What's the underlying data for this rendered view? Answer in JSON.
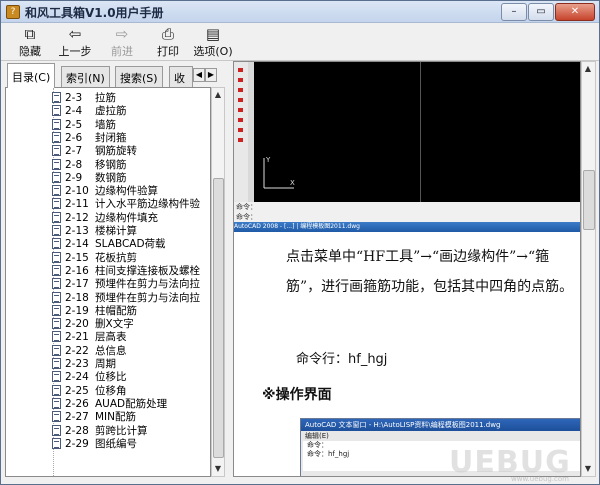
{
  "window": {
    "title": "和风工具箱V1.0用户手册",
    "app_icon_glyph": "?",
    "minimize_glyph": "–",
    "restore_glyph": "▭",
    "close_glyph": "✕"
  },
  "toolbar": {
    "hide": {
      "label": "隐藏",
      "icon": "hide-icon",
      "glyph": "⧉"
    },
    "back": {
      "label": "上一步",
      "icon": "back-arrow-icon",
      "glyph": "⇦"
    },
    "forward": {
      "label": "前进",
      "icon": "forward-arrow-icon",
      "glyph": "⇨"
    },
    "print": {
      "label": "打印",
      "icon": "print-icon",
      "glyph": "⎙"
    },
    "options": {
      "label": "选项(O)",
      "icon": "options-icon",
      "glyph": "▤"
    }
  },
  "nav": {
    "tabs": [
      {
        "label": "目录(C)",
        "active": true
      },
      {
        "label": "索引(N)",
        "active": false
      },
      {
        "label": "搜索(S)",
        "active": false
      },
      {
        "label": "收",
        "active": false
      }
    ],
    "tab_left_arrow": "◀",
    "tab_right_arrow": "▶",
    "scroll_up": "▲",
    "scroll_down": "▼",
    "items": [
      {
        "num": "2-3",
        "label": "拉筋"
      },
      {
        "num": "2-4",
        "label": "虚拉筋"
      },
      {
        "num": "2-5",
        "label": "墙筋"
      },
      {
        "num": "2-6",
        "label": "封闭箍"
      },
      {
        "num": "2-7",
        "label": "钢筋旋转"
      },
      {
        "num": "2-8",
        "label": "移钢筋"
      },
      {
        "num": "2-9",
        "label": "数钢筋"
      },
      {
        "num": "2-10",
        "label": "边缘构件验算"
      },
      {
        "num": "2-11",
        "label": "计入水平筋边缘构件验"
      },
      {
        "num": "2-12",
        "label": "边缘构件填充"
      },
      {
        "num": "2-13",
        "label": "楼梯计算"
      },
      {
        "num": "2-14",
        "label": "SLABCAD荷载"
      },
      {
        "num": "2-15",
        "label": "花板抗剪"
      },
      {
        "num": "2-16",
        "label": "柱间支撑连接板及螺栓"
      },
      {
        "num": "2-17",
        "label": "预埋件在剪力与法向拉"
      },
      {
        "num": "2-18",
        "label": "预埋件在剪力与法向拉"
      },
      {
        "num": "2-19",
        "label": "柱帽配筋"
      },
      {
        "num": "2-20",
        "label": "删X文字"
      },
      {
        "num": "2-21",
        "label": "层高表"
      },
      {
        "num": "2-22",
        "label": "总信息"
      },
      {
        "num": "2-23",
        "label": "周期"
      },
      {
        "num": "2-24",
        "label": "位移比"
      },
      {
        "num": "2-25",
        "label": "位移角"
      },
      {
        "num": "2-26",
        "label": "AUAD配筋处理"
      },
      {
        "num": "2-27",
        "label": "MIN配筋"
      },
      {
        "num": "2-28",
        "label": "剪跨比计算"
      },
      {
        "num": "2-29",
        "label": "图纸编号"
      }
    ]
  },
  "content": {
    "paragraph": "点击菜单中“HF工具”→“画边缘构件”→“箍筋”，进行画箍筋功能，包括其中四角的点筋。",
    "command_line": "命令行：hf_hgj",
    "section_title": "※操作界面",
    "embedded_window_title": "AutoCAD 文本窗口 - H:\\AutoLISP资料\\编程模板图2011.dwg",
    "embedded_menu": "编辑(E)",
    "embedded_lines": [
      "命令：",
      "命令：hf_hgj"
    ],
    "cad_axis_y": "Y",
    "cad_axis_x": "X",
    "cad_cmd_line1": "命令：",
    "cad_cmd_line2": "命令：",
    "taskbar_text": "AutoCAD 2008 - [...] | 编程模板图2011.dwg"
  },
  "watermark": {
    "text": "UEBUG",
    "sub": "www.uebug.com"
  }
}
